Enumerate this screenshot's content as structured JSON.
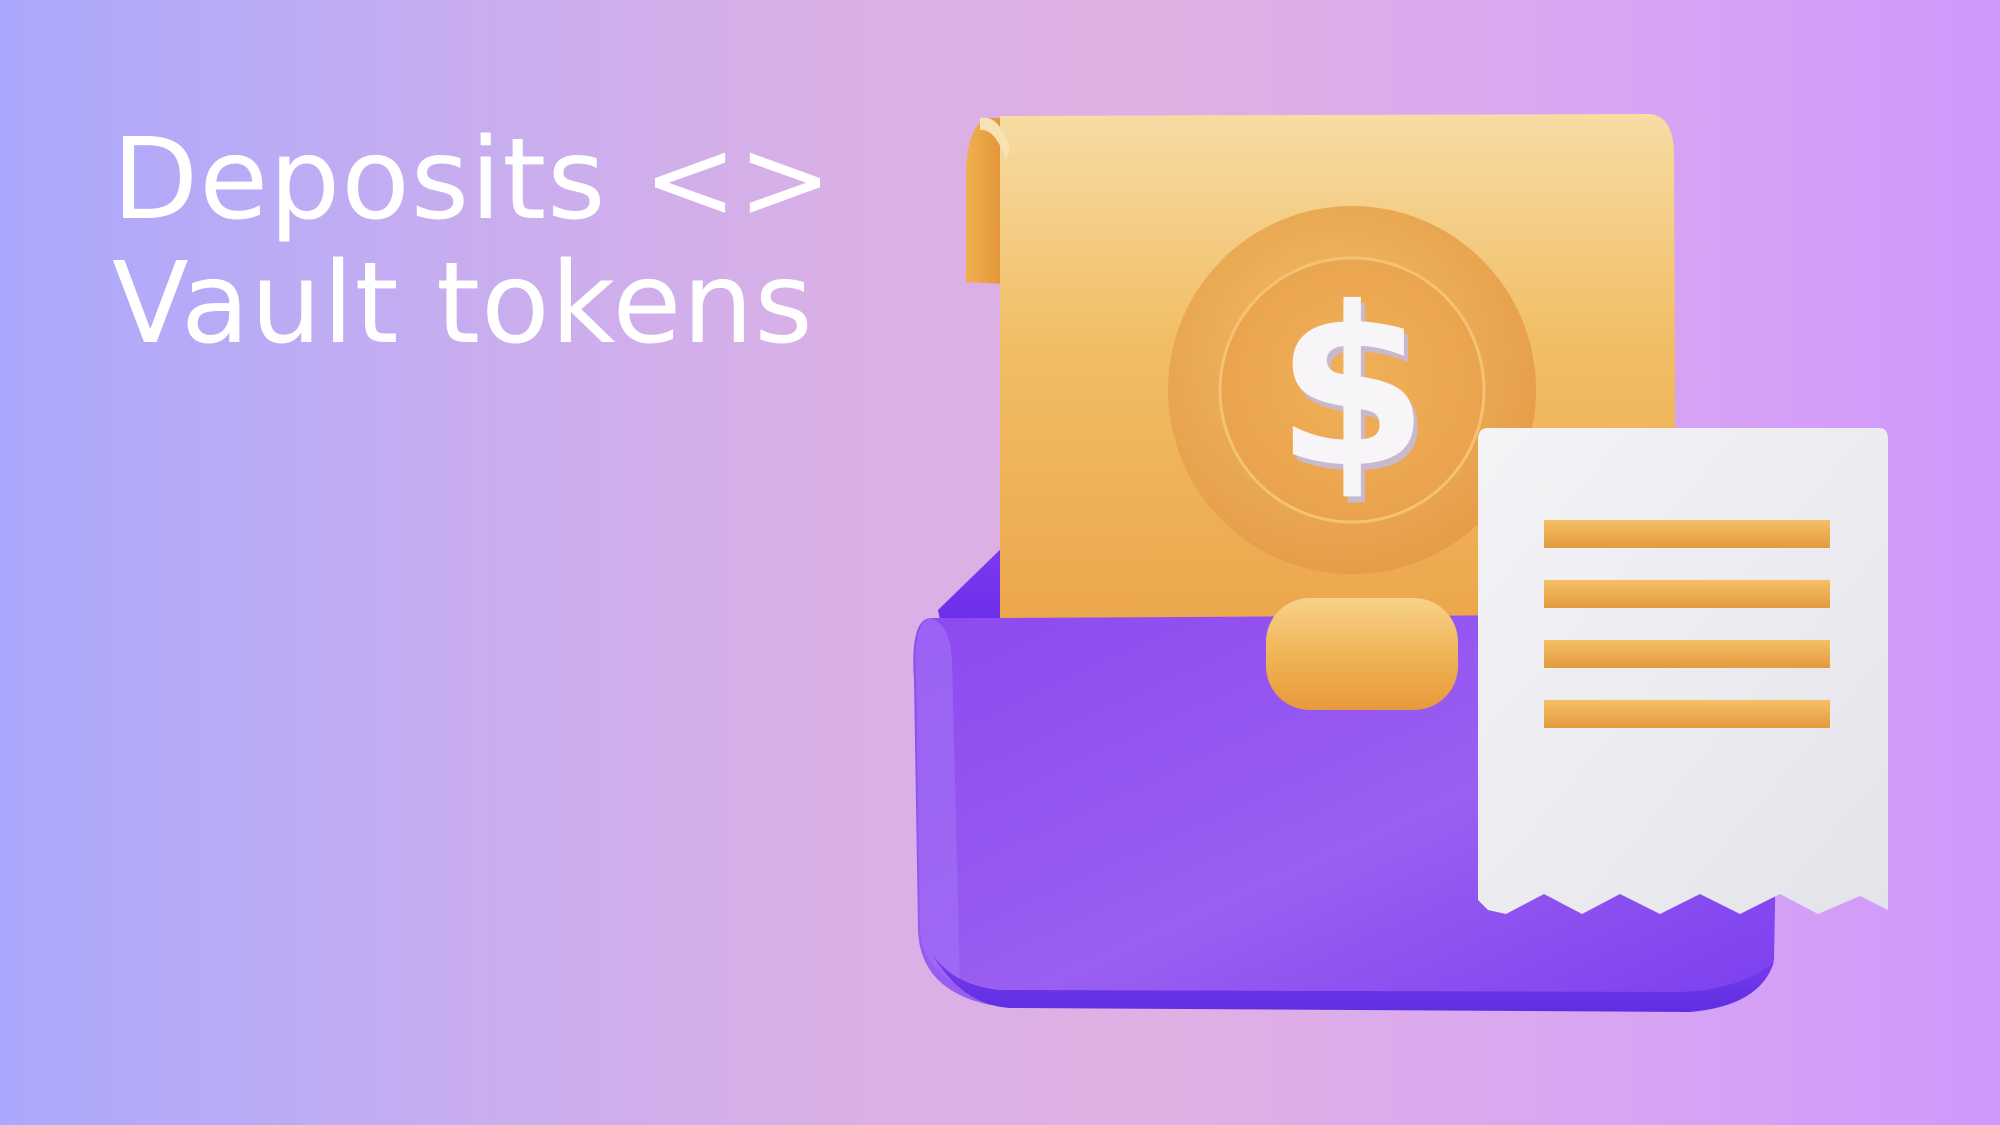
{
  "headline": {
    "line1": "Deposits <>",
    "line2": "Vault tokens"
  },
  "illustration": {
    "coin_symbol": "$",
    "icons": [
      "wallet-icon",
      "dollar-coin-icon",
      "receipt-icon"
    ]
  },
  "colors": {
    "background_left": "#aaa8fd",
    "background_right": "#d097fd",
    "headline_text": "#ffffff",
    "wallet_purple": "#8b4ef0",
    "paper_orange": "#f2c06a",
    "receipt_white": "#ededf1",
    "receipt_lines": "#eeb04a"
  }
}
